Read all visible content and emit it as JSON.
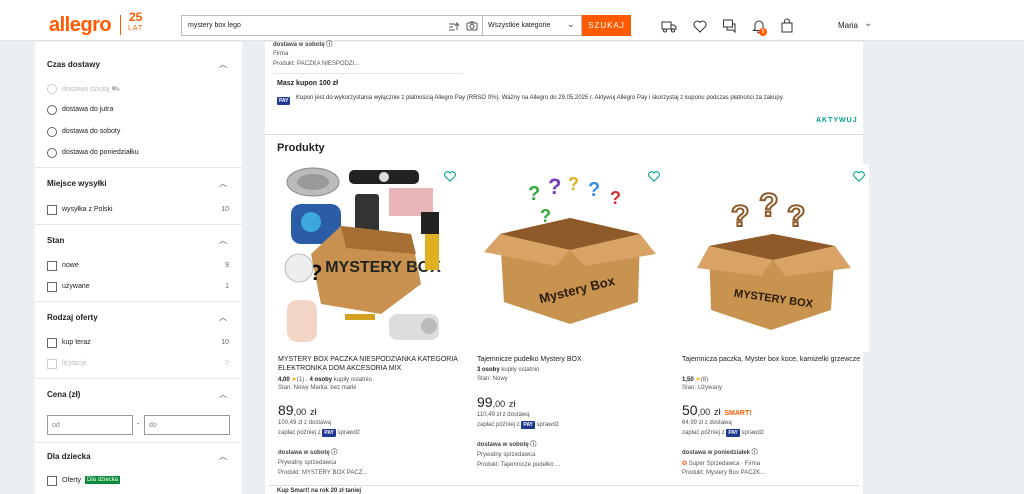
{
  "header": {
    "logo": "allegro",
    "anniversary_number": "25",
    "anniversary_text": "LAT",
    "search_value": "mystery box lego",
    "category": "Wszystkie kategorie",
    "search_button": "SZUKAJ",
    "notifications_count": "8",
    "user_name": "Maria"
  },
  "sidebar": {
    "delivery_time": {
      "title": "Czas dostawy",
      "options": [
        "dostawa dzisiaj",
        "dostawa do jutra",
        "dostawa do soboty",
        "dostawa do poniedziałku"
      ]
    },
    "ship_from": {
      "title": "Miejsce wysyłki",
      "options": [
        {
          "label": "wysyłka z Polski",
          "count": "10"
        }
      ]
    },
    "condition": {
      "title": "Stan",
      "options": [
        {
          "label": "nowe",
          "count": "9"
        },
        {
          "label": "używane",
          "count": "1"
        }
      ]
    },
    "offer_type": {
      "title": "Rodzaj oferty",
      "options": [
        {
          "label": "kup teraz",
          "count": "10"
        },
        {
          "label": "licytacje",
          "count": "0"
        }
      ]
    },
    "price": {
      "title": "Cena (zł)",
      "from_placeholder": "od",
      "to_placeholder": "do",
      "dash": "-"
    },
    "for_child": {
      "title": "Dla dziecka",
      "option": "Oferty",
      "badge": "Dla dziecka"
    }
  },
  "main": {
    "top_offer": {
      "delivery": "dostawa w sobotę",
      "seller": "Firma",
      "product": "Produkt: PACZKA NIESPODZI..."
    },
    "coupon": {
      "title": "Masz kupon 100 zł",
      "pay_badge": "PAY",
      "text": "Kupon jest do wykorzystania wyłącznie z płatnością Allegro Pay (RRSO 0%). Ważny na Allegro do 29.05.2025 r. Aktywuj Allegro Pay i skorzystaj z kuponu podczas płatności za zakupy.",
      "action": "AKTYWUJ"
    },
    "products_heading": "Produkty",
    "products": [
      {
        "image_text": "MYSTERY BOX",
        "title": "MYSTERY BOX PACZKA NIESPODZIANKA KATEGORIA ELEKTRONIKA DOM AKCESORIA MIX",
        "rating": "4,00",
        "reviews": "(1)",
        "buyers": "4 osoby",
        "buyers_suffix": "kupiły ostatnio",
        "meta": "Stan: Nowy   Marka: bez marki",
        "price_int": "89",
        "price_dec": ",00",
        "currency": "zł",
        "with_delivery": "100,49 zł z dostawą",
        "pay_later": "zapłać później z",
        "check": "sprawdź",
        "delivery": "dostawa w sobotę",
        "seller": "Prywatny sprzedawca",
        "product_ref": "Produkt: MYSTERY BOX PACZ..."
      },
      {
        "image_text": "Mystery Box",
        "title": "Tajemnicze pudełko Mystery BOX",
        "buyers": "3 osoby",
        "buyers_suffix": "kupiły ostatnio",
        "meta": "Stan: Nowy",
        "price_int": "99",
        "price_dec": ",00",
        "currency": "zł",
        "with_delivery": "110,49 zł z dostawą",
        "pay_later": "zapłać później z",
        "check": "sprawdź",
        "delivery": "dostawa w sobotę",
        "seller": "Prywatny sprzedawca",
        "product_ref": "Produkt: Tajemnicze pudełko ..."
      },
      {
        "image_text": "MYSTERY BOX",
        "title": "Tajemnicza paczka, Myster box koce, kamizelki grzewcze",
        "rating": "1,50",
        "reviews": "(8)",
        "meta": "Stan: Używany",
        "price_int": "50",
        "price_dec": ",00",
        "currency": "zł",
        "smart": "SMART!",
        "with_delivery": "64,99 zł z dostawą",
        "pay_later": "zapłać później z",
        "check": "sprawdź",
        "delivery": "dostawa w poniedziałek",
        "seller": "Super Sprzedawca · Firma",
        "product_ref": "Produkt: Mystery Box PACZK..."
      }
    ],
    "bottom_cut": "Kup Smart! na rok 20 zł taniej"
  },
  "colors": {
    "brand": "#ff5a00",
    "accent": "#00a790",
    "pay": "#1f3a93"
  }
}
